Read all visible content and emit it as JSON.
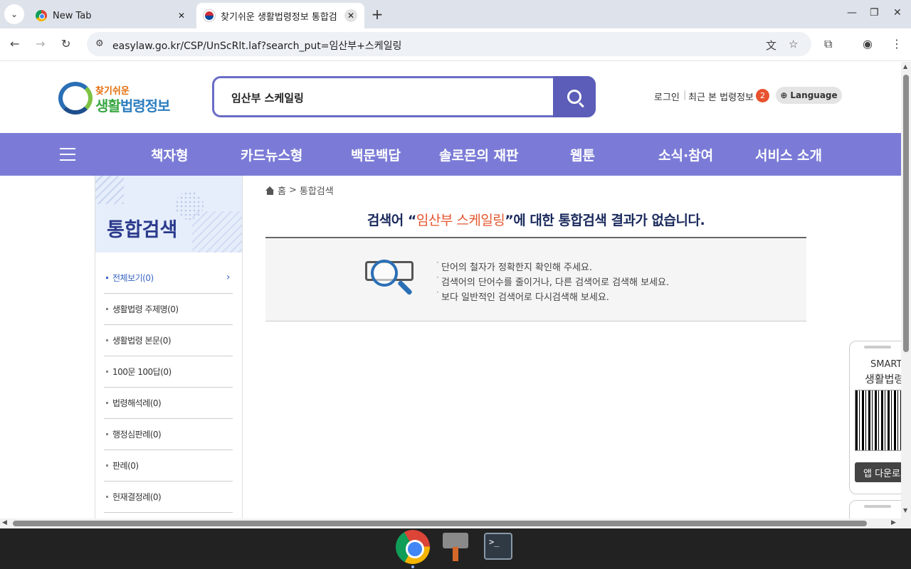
{
  "browser": {
    "tabs": [
      {
        "title": "New Tab",
        "active": false
      },
      {
        "title": "찾기쉬운 생활법령정보 통합검",
        "active": true
      }
    ],
    "url": "easylaw.go.kr/CSP/UnScRlt.laf?search_put=임산부+스케일링"
  },
  "header": {
    "logo_line1": "찾기쉬운",
    "logo_line2_a": "생활",
    "logo_line2_b": "법령정보",
    "search_value": "임산부 스케일링",
    "login": "로그인",
    "recent": "최근 본 법령정보",
    "recent_count": "2",
    "language": "Language"
  },
  "gnb": [
    "책자형",
    "카드뉴스형",
    "백문백답",
    "솔로몬의 재판",
    "웹툰",
    "소식·참여",
    "서비스 소개"
  ],
  "lnb": {
    "title": "통합검색",
    "items": [
      "전체보기(0)",
      "생활법령 주제명(0)",
      "생활법령 본문(0)",
      "100문 100답(0)",
      "법령해석례(0)",
      "행정심판례(0)",
      "판례(0)",
      "헌재결정례(0)"
    ]
  },
  "content": {
    "breadcrumb_home": "홈",
    "breadcrumb_sep": ">",
    "breadcrumb_current": "통합검색",
    "title_prefix": "검색어 “",
    "title_keyword": "임산부 스케일링",
    "title_suffix": "”에 대한 통합검색 결과가 없습니다.",
    "tips": [
      "단어의 철자가 정확한지 확인해 주세요.",
      "검색어의 단어수를 줄이거나, 다른 검색어로 검색해 보세요.",
      "보다 일반적인 검색어로 다시검색해 보세요."
    ]
  },
  "side_panel": {
    "line1": "SMART",
    "line2": "생활법령",
    "button": "앱 다운로드"
  },
  "colors": {
    "gnb": "#7b7bd7",
    "search_border": "#6a6cc6",
    "keyword": "#e4572e",
    "title": "#1a2a5c"
  }
}
